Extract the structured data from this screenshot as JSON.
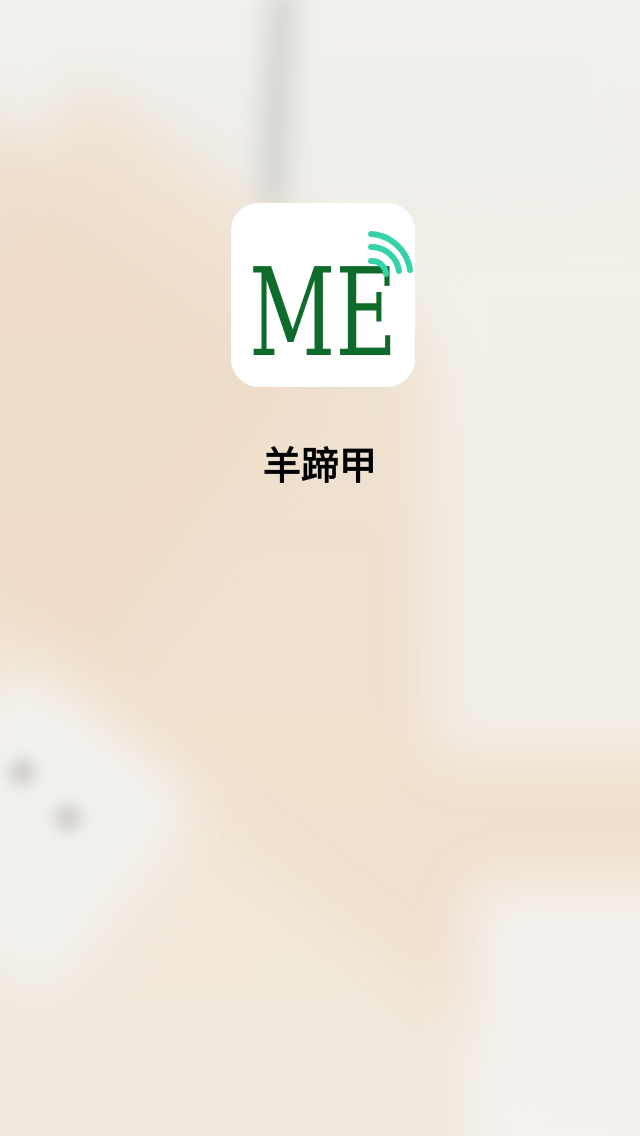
{
  "splash": {
    "app_name": "羊蹄甲",
    "logo": {
      "icon": "me-wifi-logo-icon",
      "letters": "ME",
      "letter_color": "#0f6b2a",
      "signal_color": "#35d1a9",
      "background": "#ffffff"
    }
  }
}
